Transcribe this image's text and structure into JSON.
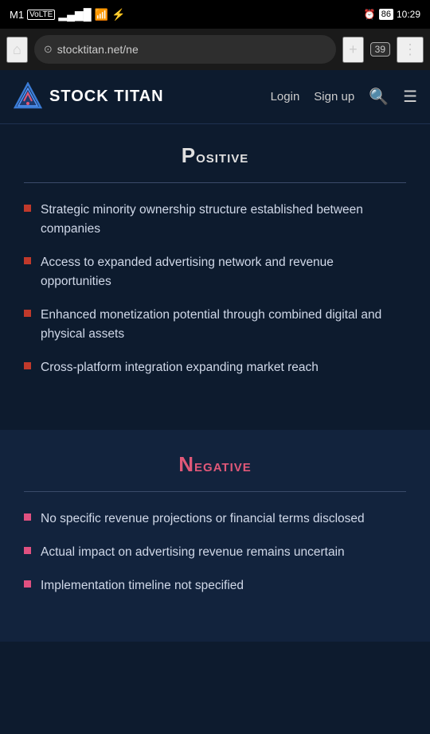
{
  "statusBar": {
    "carrier": "M1",
    "volte": "VoLTE",
    "signal": "●●●●",
    "wifi": "WiFi",
    "alarm": "⏰",
    "battery": "86",
    "time": "10:29"
  },
  "browserBar": {
    "homeIcon": "⌂",
    "url": "stocktitan.net/ne",
    "newTabIcon": "+",
    "tabCount": "39",
    "menuIcon": "⋮"
  },
  "navbar": {
    "logoText": "STOCK TITAN",
    "loginLabel": "Login",
    "signupLabel": "Sign up"
  },
  "positiveSection": {
    "title": "Positive",
    "bullets": [
      "Strategic minority ownership structure established between companies",
      "Access to expanded advertising network and revenue opportunities",
      "Enhanced monetization potential through combined digital and physical assets",
      "Cross-platform integration expanding market reach"
    ]
  },
  "negativeSection": {
    "title": "Negative",
    "bullets": [
      "No specific revenue projections or financial terms disclosed",
      "Actual impact on advertising revenue remains uncertain",
      "Implementation timeline not specified"
    ]
  }
}
